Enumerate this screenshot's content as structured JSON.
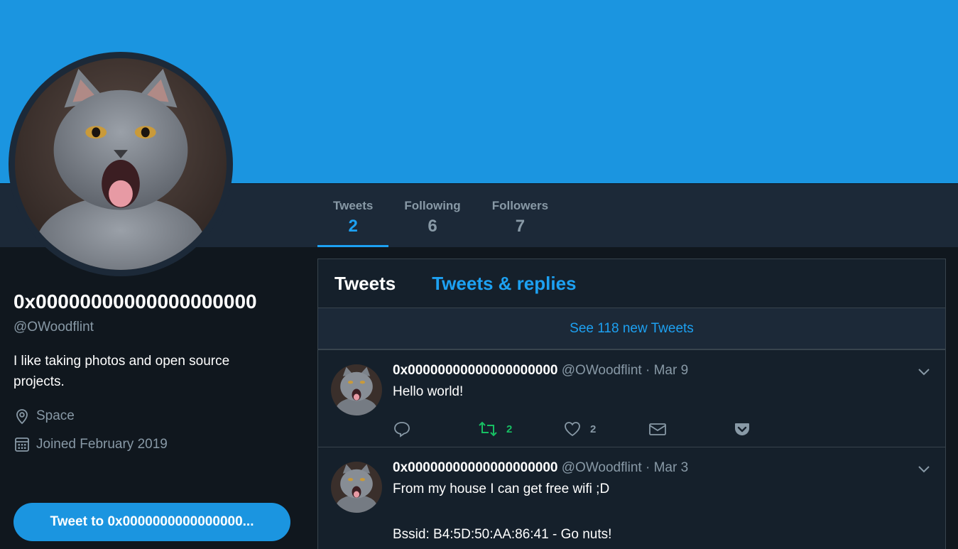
{
  "profile": {
    "display_name": "0x00000000000000000000",
    "handle": "@OWoodflint",
    "bio": "I like taking photos and open source projects.",
    "location": "Space",
    "joined": "Joined February 2019",
    "tweet_to_label": "Tweet to 0x0000000000000000..."
  },
  "stats": [
    {
      "label": "Tweets",
      "value": "2",
      "active": true
    },
    {
      "label": "Following",
      "value": "6",
      "active": false
    },
    {
      "label": "Followers",
      "value": "7",
      "active": false
    }
  ],
  "timeline": {
    "tabs": [
      {
        "label": "Tweets",
        "active": true
      },
      {
        "label": "Tweets & replies",
        "active": false
      }
    ],
    "new_tweets_label": "See 118 new Tweets"
  },
  "tweets": [
    {
      "name": "0x00000000000000000000",
      "handle": "@OWoodflint",
      "separator": "·",
      "date": "Mar 9",
      "text": "Hello world!",
      "retweets": "2",
      "likes": "2"
    },
    {
      "name": "0x00000000000000000000",
      "handle": "@OWoodflint",
      "separator": "·",
      "date": "Mar 3",
      "text_lines": [
        "From my house I can get free wifi ;D",
        "",
        "Bssid: B4:5D:50:AA:86:41 - Go nuts!"
      ]
    }
  ],
  "icons": {
    "location": "map-pin-icon",
    "joined": "calendar-icon",
    "reply": "reply-icon",
    "retweet": "retweet-icon",
    "like": "heart-icon",
    "dm": "mail-icon",
    "pocket": "pocket-icon",
    "caret": "chevron-down-icon"
  },
  "colors": {
    "banner": "#1b95e0",
    "accent": "#1da1f2",
    "retweet_green": "#17bf63",
    "background": "#10171e",
    "panel": "#15202b",
    "muted_text": "#8899a6"
  }
}
